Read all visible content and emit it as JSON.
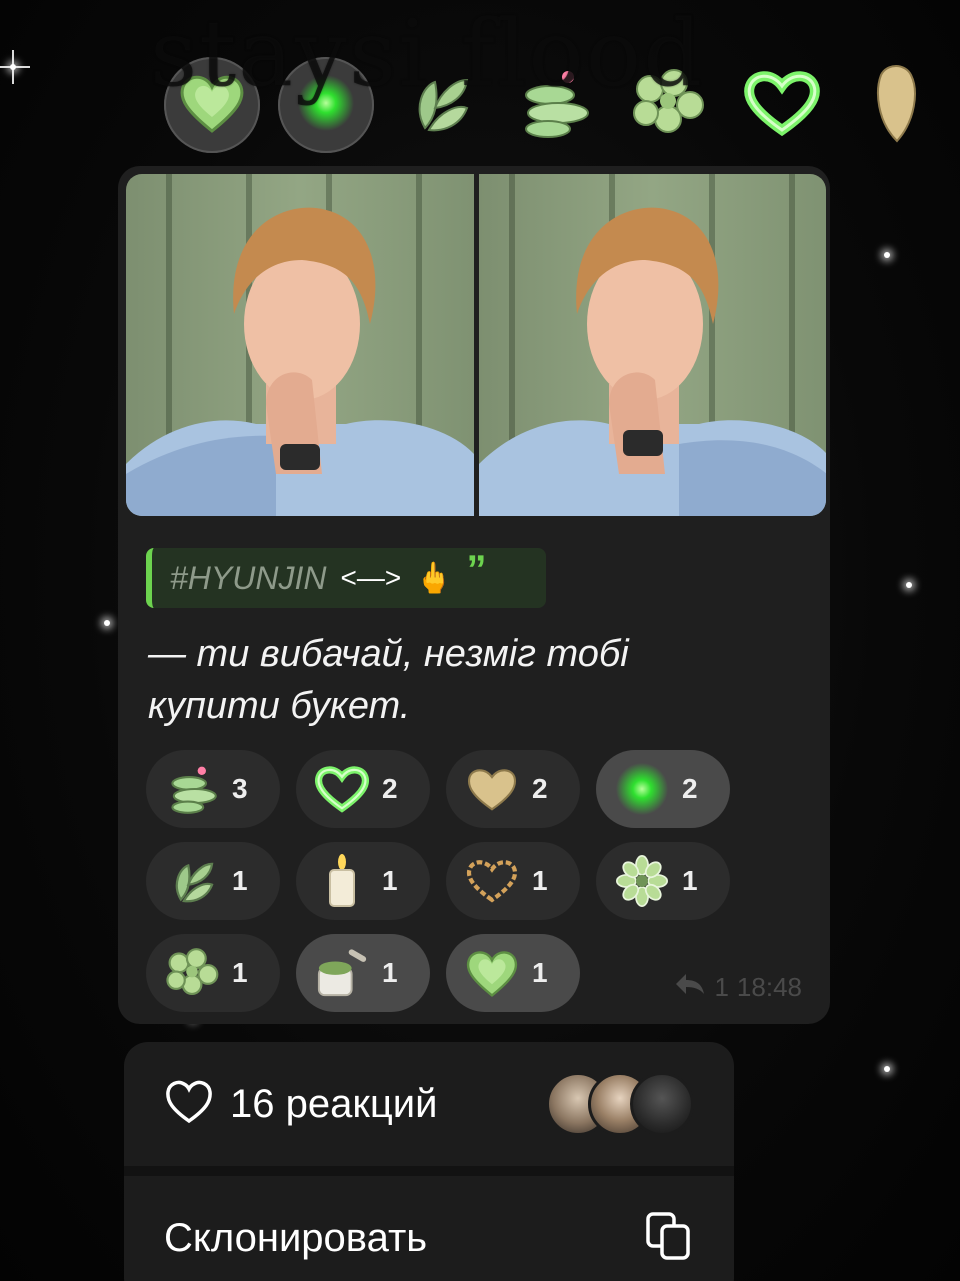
{
  "watermark": "staysi flood",
  "picker": {
    "items": [
      {
        "name": "green-glass-heart-icon",
        "selected": true
      },
      {
        "name": "green-glow-dot-icon",
        "selected": true
      },
      {
        "name": "green-leaves-icon",
        "selected": false
      },
      {
        "name": "lily-pad-icon",
        "selected": false
      },
      {
        "name": "green-clover-icon",
        "selected": false
      },
      {
        "name": "green-neon-heart-icon",
        "selected": false
      },
      {
        "name": "beige-heart-icon",
        "selected": false
      }
    ]
  },
  "message": {
    "quote": {
      "tag": "#HYUNJIN",
      "arrow": "<—>",
      "hand": "🖕"
    },
    "text": "— ти вибачай, незміг тобі купити букет.",
    "reactions": [
      [
        {
          "icon": "lily-pad-icon",
          "count": "3",
          "active": false
        },
        {
          "icon": "green-neon-heart-icon",
          "count": "2",
          "active": false
        },
        {
          "icon": "beige-heart-icon",
          "count": "2",
          "active": false
        },
        {
          "icon": "green-glow-dot-icon",
          "count": "2",
          "active": true
        }
      ],
      [
        {
          "icon": "green-leaves-icon",
          "count": "1",
          "active": false
        },
        {
          "icon": "candle-icon",
          "count": "1",
          "active": false
        },
        {
          "icon": "bead-heart-icon",
          "count": "1",
          "active": false
        },
        {
          "icon": "green-flower-icon",
          "count": "1",
          "active": false
        }
      ],
      [
        {
          "icon": "green-clover-icon",
          "count": "1",
          "active": false
        },
        {
          "icon": "matcha-jar-icon",
          "count": "1",
          "active": true
        },
        {
          "icon": "green-glass-heart-icon",
          "count": "1",
          "active": true
        }
      ]
    ],
    "replies": "1",
    "time": "18:48"
  },
  "menu": {
    "reactions_label": "16 реакций",
    "clone_label": "Склонировать"
  },
  "colors": {
    "accent": "#6dd34f",
    "bubble": "#1f1f1f",
    "chip": "#2c2c2c",
    "chip_active": "#4a4a4a"
  }
}
